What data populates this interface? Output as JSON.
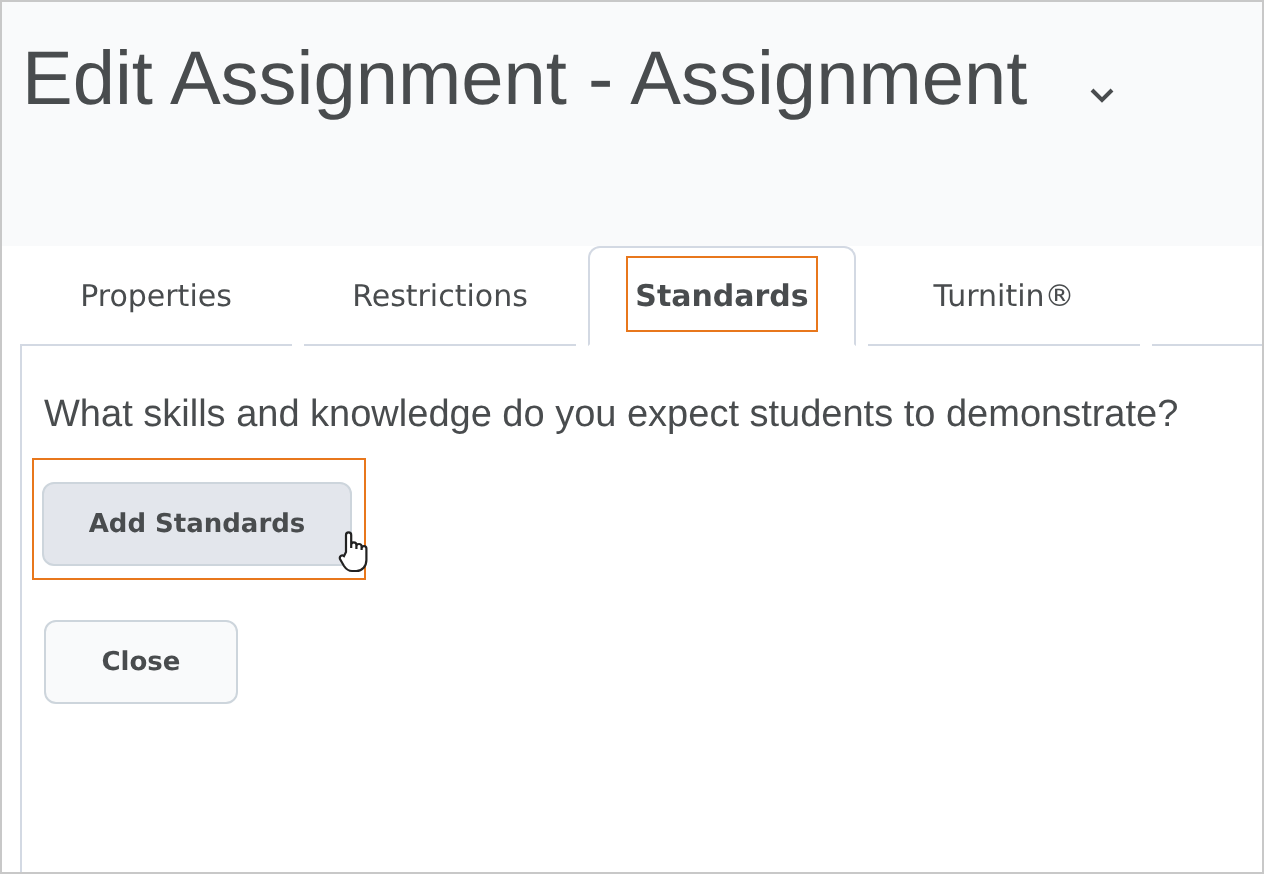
{
  "title": "Edit Assignment - Assignment",
  "title_menu": {
    "expanded": false
  },
  "tabs": [
    {
      "label": "Properties",
      "selected": false,
      "highlighted": false
    },
    {
      "label": "Restrictions",
      "selected": false,
      "highlighted": false
    },
    {
      "label": "Standards",
      "selected": true,
      "highlighted": true
    },
    {
      "label": "Turnitin®",
      "selected": false,
      "highlighted": false
    }
  ],
  "question": "What skills and knowledge do you expect students to demonstrate?",
  "buttons": [
    {
      "label": "Add Standards",
      "kind": "primary",
      "highlighted": true,
      "hovered": true
    },
    {
      "label": "Close",
      "kind": "secondary",
      "highlighted": false,
      "hovered": false
    }
  ]
}
